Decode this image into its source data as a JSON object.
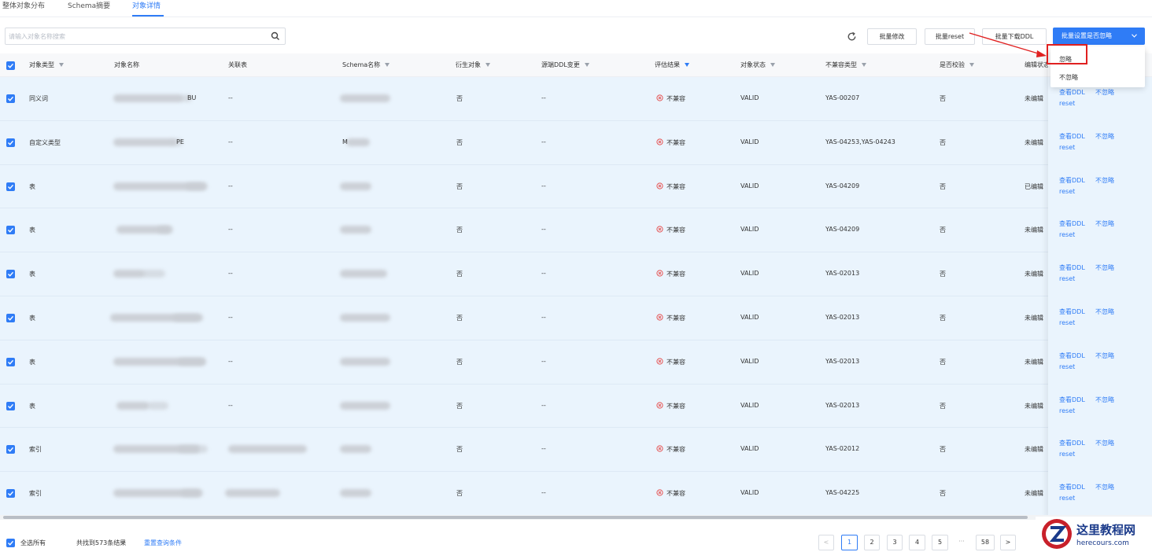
{
  "tabs": [
    "整体对象分布",
    "Schema摘要",
    "对象详情"
  ],
  "search": {
    "placeholder": "请输入对象名称搜索",
    "value": ""
  },
  "toolbar": {
    "batch_modify": "批量修改",
    "batch_reset": "批量reset",
    "batch_download": "批量下载DDL",
    "batch_ignore": "批量设置是否忽略"
  },
  "dropdown": {
    "items": [
      "忽略",
      "不忽略"
    ]
  },
  "columns": [
    "对象类型",
    "对象名称",
    "关联表",
    "Schema名称",
    "衍生对象",
    "源端DDL变更",
    "评估结果",
    "对象状态",
    "不兼容类型",
    "是否校验",
    "编辑状态"
  ],
  "rows": [
    {
      "type": "同义词",
      "obj_suffix": "BU",
      "schema_suffix": "",
      "related": "--",
      "derived": "否",
      "ddl": "--",
      "result": "不兼容",
      "status": "VALID",
      "code": "YAS-00207",
      "check": "否",
      "edit": "未编辑"
    },
    {
      "type": "自定义类型",
      "obj_suffix": "PE",
      "schema_suffix": "M",
      "related": "--",
      "derived": "否",
      "ddl": "--",
      "result": "不兼容",
      "status": "VALID",
      "code": "YAS-04253,YAS-04243",
      "check": "否",
      "edit": "未编辑"
    },
    {
      "type": "表",
      "obj_suffix": "",
      "schema_suffix": "",
      "related": "--",
      "derived": "否",
      "ddl": "--",
      "result": "不兼容",
      "status": "VALID",
      "code": "YAS-04209",
      "check": "否",
      "edit": "已编辑"
    },
    {
      "type": "表",
      "obj_suffix": "",
      "schema_suffix": "",
      "related": "--",
      "derived": "否",
      "ddl": "--",
      "result": "不兼容",
      "status": "VALID",
      "code": "YAS-04209",
      "check": "否",
      "edit": "未编辑"
    },
    {
      "type": "表",
      "obj_suffix": "",
      "schema_suffix": "",
      "related": "--",
      "derived": "否",
      "ddl": "--",
      "result": "不兼容",
      "status": "VALID",
      "code": "YAS-02013",
      "check": "否",
      "edit": "未编辑"
    },
    {
      "type": "表",
      "obj_suffix": "",
      "schema_suffix": "",
      "related": "--",
      "derived": "否",
      "ddl": "--",
      "result": "不兼容",
      "status": "VALID",
      "code": "YAS-02013",
      "check": "否",
      "edit": "未编辑"
    },
    {
      "type": "表",
      "obj_suffix": "",
      "schema_suffix": "",
      "related": "--",
      "derived": "否",
      "ddl": "--",
      "result": "不兼容",
      "status": "VALID",
      "code": "YAS-02013",
      "check": "否",
      "edit": "未编辑"
    },
    {
      "type": "表",
      "obj_suffix": "",
      "schema_suffix": "",
      "related": "--",
      "derived": "否",
      "ddl": "--",
      "result": "不兼容",
      "status": "VALID",
      "code": "YAS-02013",
      "check": "否",
      "edit": "未编辑"
    },
    {
      "type": "索引",
      "obj_suffix": "",
      "schema_suffix": "",
      "related": "",
      "derived": "否",
      "ddl": "--",
      "result": "不兼容",
      "status": "VALID",
      "code": "YAS-02012",
      "check": "否",
      "edit": "未编辑"
    },
    {
      "type": "索引",
      "obj_suffix": "",
      "schema_suffix": "",
      "related": "",
      "derived": "否",
      "ddl": "--",
      "result": "不兼容",
      "status": "VALID",
      "code": "YAS-04225",
      "check": "否",
      "edit": "未编辑"
    }
  ],
  "actions": {
    "view_ddl": "查看DDL",
    "ignore": "不忽略",
    "reset": "reset"
  },
  "footer": {
    "select_all": "全选所有",
    "total": "共找到573条结果",
    "reset_query": "重置查询条件"
  },
  "pagination": {
    "pages": [
      "1",
      "2",
      "3",
      "4",
      "5",
      "···",
      "58"
    ],
    "current": "1",
    "prev": "<",
    "next": ">"
  },
  "watermark": {
    "title": "这里教程网",
    "url": "herecours.com"
  },
  "colors": {
    "accent": "#2f7cf6",
    "row_bg": "#eaf4fd",
    "error": "#e55353",
    "highlight": "#e02020"
  }
}
